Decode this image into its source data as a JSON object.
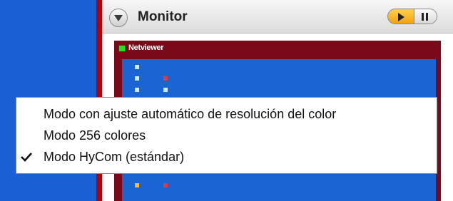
{
  "panel": {
    "title": "Monitor",
    "controls": {
      "play_icon": "play-icon",
      "pause_icon": "pause-icon"
    }
  },
  "netviewer": {
    "title": "Netviewer",
    "status_color": "#27e01b",
    "frame_color": "#7a0a1a"
  },
  "context_menu": {
    "items": [
      {
        "label": "Modo con ajuste automático de resolución del color",
        "checked": false
      },
      {
        "label": "Modo 256 colores",
        "checked": false
      },
      {
        "label": "Modo HyCom (estándar)",
        "checked": true
      }
    ]
  },
  "colors": {
    "desktop_blue": "#1a5fd4",
    "accent_orange": "#f3a20c"
  }
}
